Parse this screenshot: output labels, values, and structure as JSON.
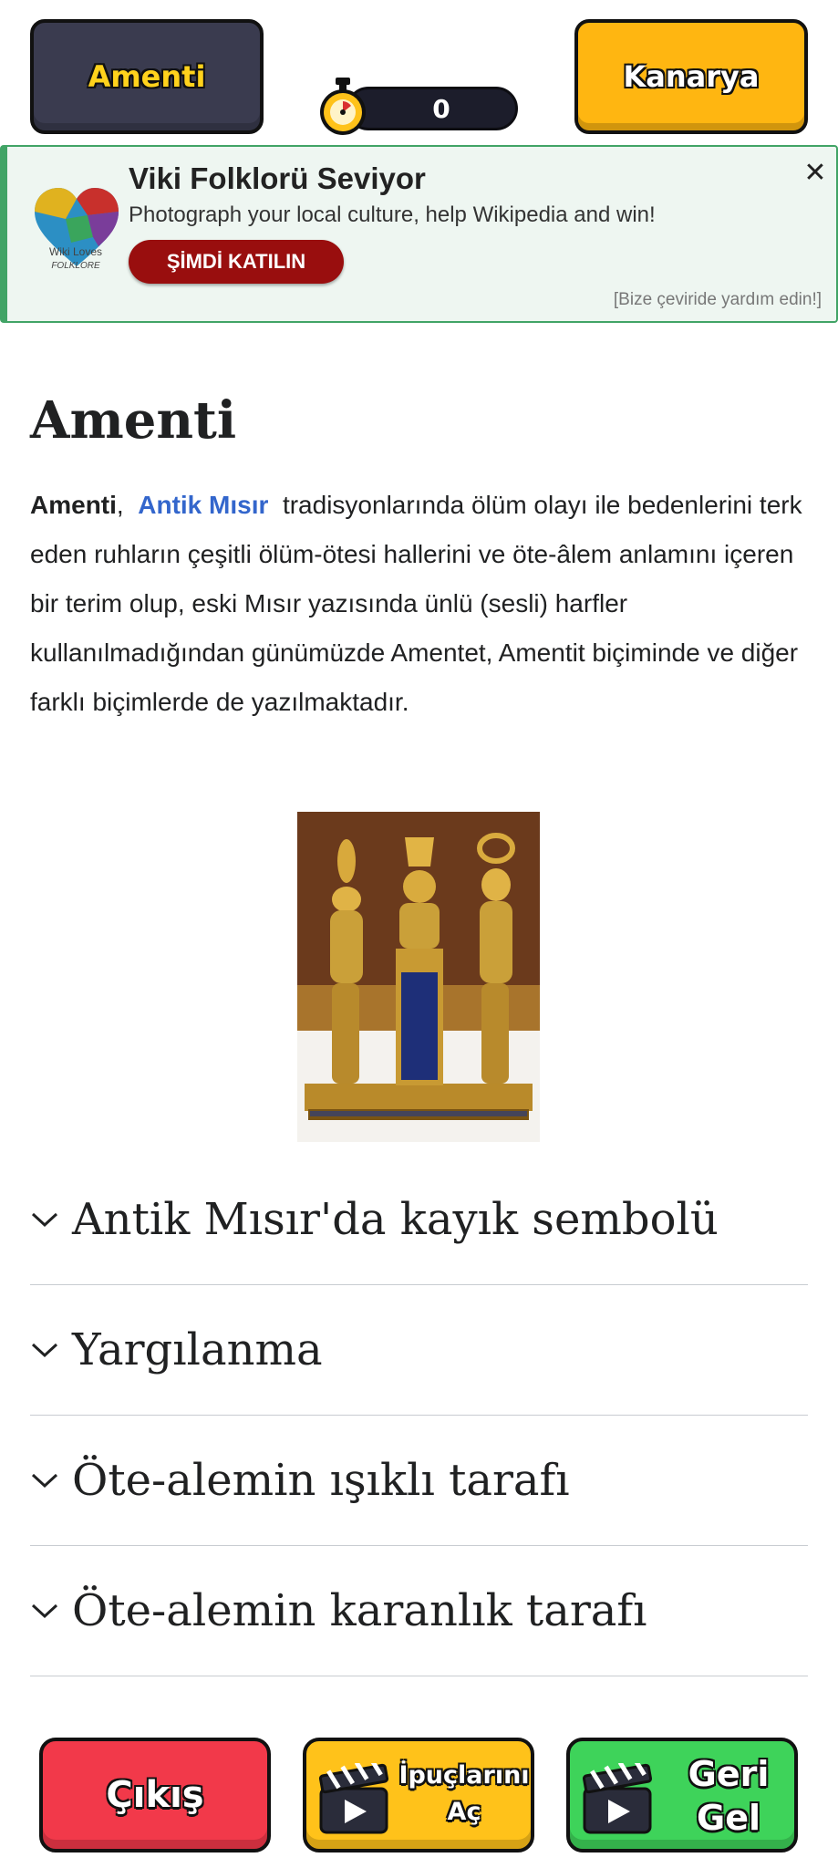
{
  "game": {
    "target_word": "Amenti",
    "hint_button": "Kanarya",
    "timer_value": "0"
  },
  "banner": {
    "logo_caption_line1": "Wiki Loves",
    "logo_caption_line2": "FOLKLORE",
    "title": "Viki Folklorü Seviyor",
    "subtitle": "Photograph your local culture, help Wikipedia and win!",
    "cta": "ŞİMDİ KATILIN",
    "close_symbol": "✕",
    "help_link": "[Bize çeviride yardım edin!]"
  },
  "article": {
    "title": "Amenti",
    "intro_bold": "Amenti",
    "intro_sep": ",",
    "intro_link": "Antik Mısır",
    "intro_rest": "tradisyonlarında ölüm olayı ile bedenlerini terk eden ruhların çeşitli ölüm-ötesi hallerini ve öte-âlem anlamını içeren bir terim olup, eski Mısır yazısında ünlü (sesli) harfler kullanılmadığından günümüzde Amentet, Amentit biçiminde ve diğer farklı biçimlerde de yazılmaktadır.",
    "sections": [
      "Antik Mısır'da kayık sembolü",
      "Yargılanma",
      "Öte-alemin ışıklı tarafı",
      "Öte-alemin karanlık tarafı"
    ]
  },
  "bottom": {
    "exit": "Çıkış",
    "reveal": "İpuçlarını Aç",
    "back": "Geri Gel"
  },
  "colors": {
    "target_bg": "#3a3b4f",
    "hint_bg": "#ffb611",
    "banner_border": "#41a466",
    "cta_bg": "#990e0e",
    "link": "#3366cc",
    "exit_bg": "#f2394a",
    "reveal_bg": "#ffc21a",
    "back_bg": "#3ed35a"
  },
  "icons": [
    "stopwatch-icon",
    "close-icon",
    "chevron-down-icon",
    "clapperboard-icon",
    "wiki-loves-folklore-logo"
  ]
}
